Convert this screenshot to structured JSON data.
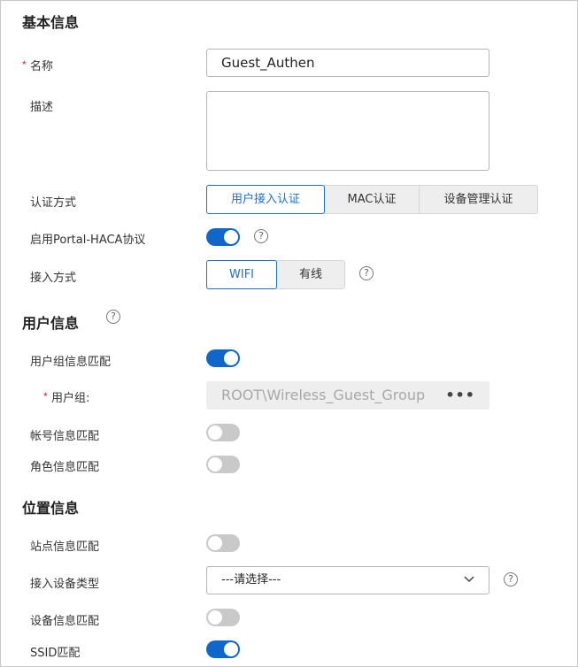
{
  "basic": {
    "title": "基本信息",
    "name_label": "名称",
    "name_value": "Guest_Authen",
    "desc_label": "描述",
    "auth_label": "认证方式",
    "auth_options": [
      "用户接入认证",
      "MAC认证",
      "设备管理认证"
    ],
    "auth_selected": "用户接入认证",
    "portal_label": "启用Portal-HACA协议",
    "portal_on": true,
    "access_label": "接入方式",
    "access_options": [
      "WIFI",
      "有线"
    ],
    "access_selected": "WIFI"
  },
  "user": {
    "title": "用户信息",
    "group_match_label": "用户组信息匹配",
    "group_match_on": true,
    "group_label": "用户组:",
    "group_value": "ROOT\\Wireless_Guest_Group",
    "group_more": "•••",
    "account_match_label": "帐号信息匹配",
    "account_match_on": false,
    "role_match_label": "角色信息匹配",
    "role_match_on": false
  },
  "location": {
    "title": "位置信息",
    "site_match_label": "站点信息匹配",
    "site_match_on": false,
    "device_type_label": "接入设备类型",
    "device_type_value": "---请选择---",
    "device_match_label": "设备信息匹配",
    "device_match_on": false,
    "ssid_match_label": "SSID匹配",
    "ssid_match_on": true
  },
  "icons": {
    "help": "question-circle-icon",
    "dropdown": "chevron-down-icon",
    "more": "ellipsis-icon"
  },
  "colors": {
    "accent": "#0f67c9",
    "required": "#e02020",
    "toggle_off": "#c9c9c9"
  }
}
